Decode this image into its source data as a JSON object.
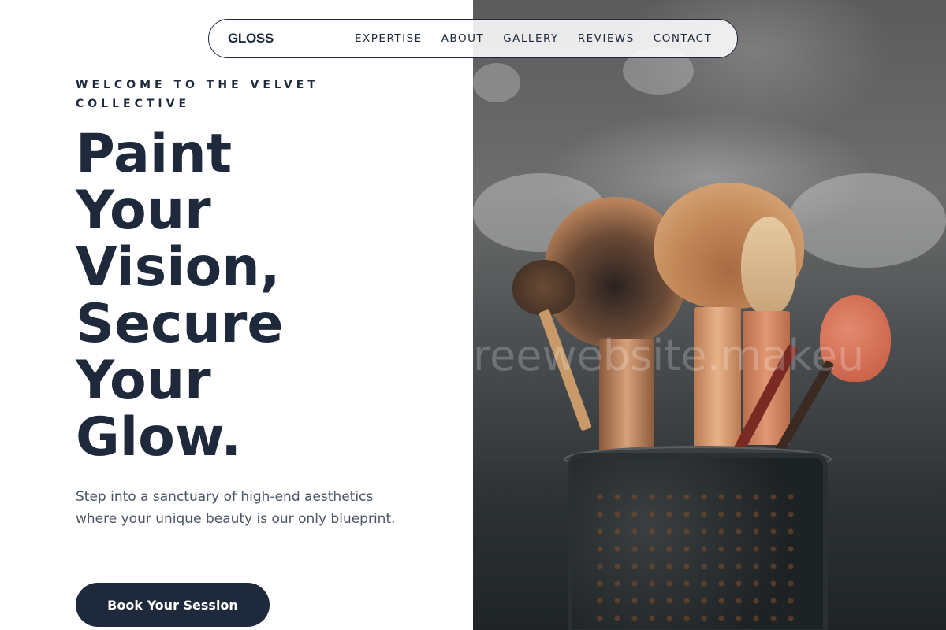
{
  "nav": {
    "logo": "GLOSS",
    "items": [
      {
        "label": "EXPERTISE"
      },
      {
        "label": "ABOUT"
      },
      {
        "label": "GALLERY"
      },
      {
        "label": "REVIEWS"
      },
      {
        "label": "CONTACT"
      }
    ]
  },
  "hero": {
    "eyebrow": "WELCOME TO THE VELVET COLLECTIVE",
    "headline_lines": [
      "Paint",
      "Your",
      "Vision,",
      "Secure",
      "Your",
      "Glow."
    ],
    "lead": "Step into a sanctuary of high-end aesthetics where your unique beauty is our only blueprint.",
    "cta_label": "Book Your Session"
  },
  "image": {
    "watermark_text": "reewebsite.makeu"
  },
  "colors": {
    "primary": "#1e293b",
    "body_text": "#4b5563",
    "background": "#ffffff"
  }
}
